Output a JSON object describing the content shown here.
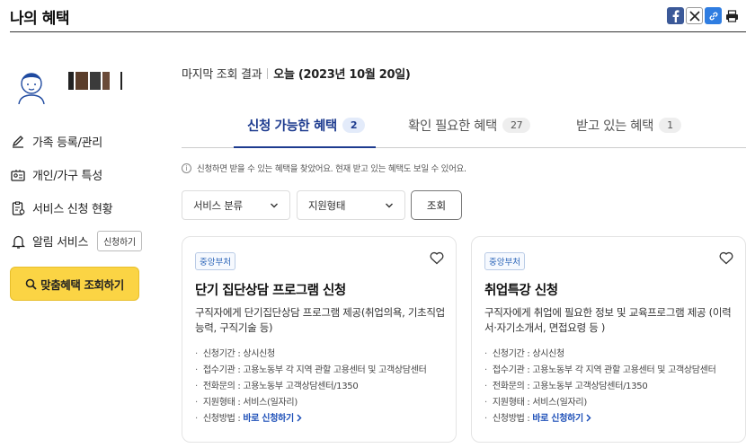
{
  "header": {
    "title": "나의 혜택",
    "share_icons": [
      "facebook-icon",
      "x-icon",
      "link-icon",
      "print-icon"
    ]
  },
  "sidebar": {
    "menu": [
      {
        "label": "가족 등록/관리",
        "icon": "pencil-icon"
      },
      {
        "label": "개인/가구 특성",
        "icon": "id-card-icon"
      },
      {
        "label": "서비스 신청 현황",
        "icon": "clipboard-icon"
      },
      {
        "label": "알림 서비스",
        "icon": "bell-icon"
      }
    ],
    "alarm_button": "신청하기",
    "lookup_button": "맞춤혜택 조회하기"
  },
  "last_check": {
    "label": "마지막 조회 결과",
    "date": "오늘 (2023년 10월 20일)"
  },
  "tabs": [
    {
      "label": "신청 가능한 혜택",
      "count": "2",
      "active": true
    },
    {
      "label": "확인 필요한 혜택",
      "count": "27",
      "active": false
    },
    {
      "label": "받고 있는 혜택",
      "count": "1",
      "active": false
    }
  ],
  "notice": "신청하면 받을 수 있는 혜택을 찾았어요. 현재 받고 있는 혜택도 보일 수 있어요.",
  "filters": {
    "category": "서비스 분류",
    "support_type": "지원형태",
    "search": "조회"
  },
  "cards": [
    {
      "badge": "중앙부처",
      "title": "단기 집단상담 프로그램 신청",
      "desc": "구직자에게 단기집단상담 프로그램 제공(취업의욕, 기초직업능력, 구직기술 등)",
      "period": "신청기간 : 상시신청",
      "agency": "접수기관 : 고용노동부 각 지역 관할 고용센터 및 고객상담센터",
      "phone": "전화문의 : 고용노동부 고객상담센터/1350",
      "support": "지원형태 : 서비스(일자리)",
      "method_label": "신청방법 : ",
      "method_link": "바로 신청하기"
    },
    {
      "badge": "중앙부처",
      "title": "취업특강 신청",
      "desc": "구직자에게 취업에 필요한 정보 및 교육프로그램 제공 (이력서·자기소개서, 면접요령 등 )",
      "period": "신청기간 : 상시신청",
      "agency": "접수기관 : 고용노동부 각 지역 관할 고용센터 및 고객상담센터",
      "phone": "전화문의 : 고용노동부 고객상담센터/1350",
      "support": "지원형태 : 서비스(일자리)",
      "method_label": "신청방법 : ",
      "method_link": "바로 신청하기"
    }
  ],
  "colors": {
    "accent": "#1d3b8f",
    "button_yellow": "#fbd444"
  }
}
